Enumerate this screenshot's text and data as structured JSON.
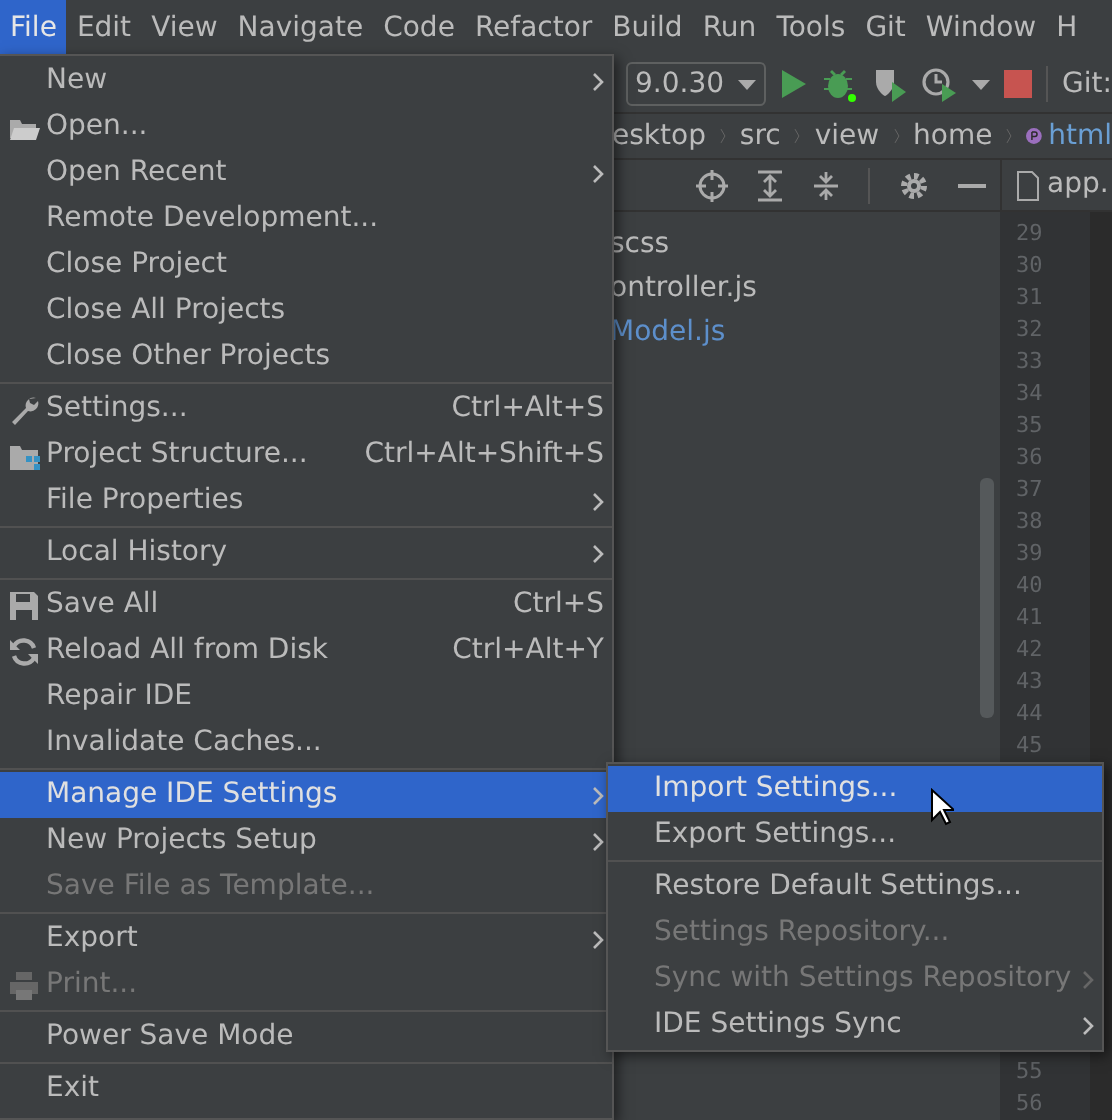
{
  "menubar": [
    {
      "label": "File",
      "selected": true
    },
    {
      "label": "Edit",
      "selected": false
    },
    {
      "label": "View",
      "selected": false
    },
    {
      "label": "Navigate",
      "selected": false
    },
    {
      "label": "Code",
      "selected": false
    },
    {
      "label": "Refactor",
      "selected": false
    },
    {
      "label": "Build",
      "selected": false
    },
    {
      "label": "Run",
      "selected": false
    },
    {
      "label": "Tools",
      "selected": false
    },
    {
      "label": "Git",
      "selected": false
    },
    {
      "label": "Window",
      "selected": false
    },
    {
      "label": "H",
      "selected": false
    }
  ],
  "toolbar": {
    "run_configuration": "9.0.30",
    "git_label": "Git:"
  },
  "breadcrumbs": [
    {
      "label": "esktop",
      "kind": "folder"
    },
    {
      "label": "src",
      "kind": "folder"
    },
    {
      "label": "view",
      "kind": "folder"
    },
    {
      "label": "home",
      "kind": "folder"
    },
    {
      "label": "html",
      "kind": "element"
    }
  ],
  "editor_tab": {
    "label": "app."
  },
  "project_tree": [
    {
      "label": "scss",
      "modified": false
    },
    {
      "label": "ontroller.js",
      "modified": false
    },
    {
      "label": "Model.js",
      "modified": true
    }
  ],
  "gutter": {
    "upper": [
      "29",
      "30",
      "31",
      "32",
      "33",
      "34",
      "35",
      "36",
      "37",
      "38",
      "39",
      "40",
      "41",
      "42",
      "43",
      "44",
      "45"
    ],
    "lower": [
      "55",
      "56"
    ]
  },
  "file_menu": {
    "items": [
      {
        "kind": "item",
        "label": "New",
        "submenu": true,
        "disabled": false,
        "selected": false
      },
      {
        "kind": "item",
        "label": "Open...",
        "submenu": false,
        "disabled": false,
        "selected": false
      },
      {
        "kind": "item",
        "label": "Open Recent",
        "submenu": true,
        "disabled": false,
        "selected": false
      },
      {
        "kind": "item",
        "label": "Remote Development...",
        "submenu": false,
        "disabled": false,
        "selected": false
      },
      {
        "kind": "item",
        "label": "Close Project",
        "submenu": false,
        "disabled": false,
        "selected": false
      },
      {
        "kind": "item",
        "label": "Close All Projects",
        "submenu": false,
        "disabled": false,
        "selected": false
      },
      {
        "kind": "item",
        "label": "Close Other Projects",
        "submenu": false,
        "disabled": false,
        "selected": false
      },
      {
        "kind": "separator"
      },
      {
        "kind": "item",
        "label": "Settings...",
        "shortcut": "Ctrl+Alt+S",
        "submenu": false,
        "disabled": false,
        "selected": false
      },
      {
        "kind": "item",
        "label": "Project Structure...",
        "shortcut": "Ctrl+Alt+Shift+S",
        "submenu": false,
        "disabled": false,
        "selected": false
      },
      {
        "kind": "item",
        "label": "File Properties",
        "submenu": true,
        "disabled": false,
        "selected": false
      },
      {
        "kind": "separator"
      },
      {
        "kind": "item",
        "label": "Local History",
        "submenu": true,
        "disabled": false,
        "selected": false
      },
      {
        "kind": "separator"
      },
      {
        "kind": "item",
        "label": "Save All",
        "shortcut": "Ctrl+S",
        "submenu": false,
        "disabled": false,
        "selected": false
      },
      {
        "kind": "item",
        "label": "Reload All from Disk",
        "shortcut": "Ctrl+Alt+Y",
        "submenu": false,
        "disabled": false,
        "selected": false
      },
      {
        "kind": "item",
        "label": "Repair IDE",
        "submenu": false,
        "disabled": false,
        "selected": false
      },
      {
        "kind": "item",
        "label": "Invalidate Caches...",
        "submenu": false,
        "disabled": false,
        "selected": false
      },
      {
        "kind": "separator"
      },
      {
        "kind": "item",
        "label": "Manage IDE Settings",
        "submenu": true,
        "disabled": false,
        "selected": true
      },
      {
        "kind": "item",
        "label": "New Projects Setup",
        "submenu": true,
        "disabled": false,
        "selected": false
      },
      {
        "kind": "item",
        "label": "Save File as Template...",
        "submenu": false,
        "disabled": true,
        "selected": false
      },
      {
        "kind": "separator"
      },
      {
        "kind": "item",
        "label": "Export",
        "submenu": true,
        "disabled": false,
        "selected": false
      },
      {
        "kind": "item",
        "label": "Print...",
        "submenu": false,
        "disabled": true,
        "selected": false
      },
      {
        "kind": "separator"
      },
      {
        "kind": "item",
        "label": "Power Save Mode",
        "submenu": false,
        "disabled": false,
        "selected": false
      },
      {
        "kind": "separator"
      },
      {
        "kind": "item",
        "label": "Exit",
        "submenu": false,
        "disabled": false,
        "selected": false
      }
    ]
  },
  "submenu": {
    "items": [
      {
        "kind": "item",
        "label": "Import Settings...",
        "submenu": false,
        "disabled": false,
        "selected": true
      },
      {
        "kind": "item",
        "label": "Export Settings...",
        "submenu": false,
        "disabled": false,
        "selected": false
      },
      {
        "kind": "separator"
      },
      {
        "kind": "item",
        "label": "Restore Default Settings...",
        "submenu": false,
        "disabled": false,
        "selected": false
      },
      {
        "kind": "item",
        "label": "Settings Repository...",
        "submenu": false,
        "disabled": true,
        "selected": false
      },
      {
        "kind": "item",
        "label": "Sync with Settings Repository",
        "submenu": true,
        "disabled": true,
        "selected": false
      },
      {
        "kind": "item",
        "label": "IDE Settings Sync",
        "submenu": true,
        "disabled": false,
        "selected": false
      }
    ]
  }
}
